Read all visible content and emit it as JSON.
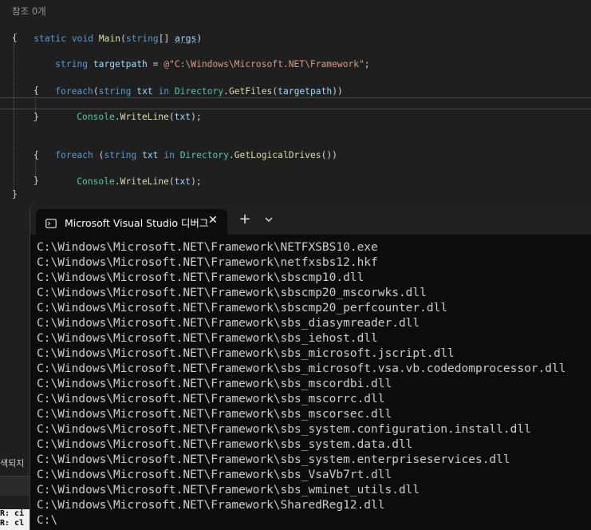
{
  "editor": {
    "codelens": "참조 0개",
    "lines": {
      "l1": {
        "kw": "static",
        "sp": " ",
        "kw2": "void",
        "sp2": " ",
        "fn": "Main",
        "p1": "(",
        "kw3": "string",
        "p2": "[] ",
        "var": "args",
        "p3": ")"
      },
      "l2": {
        "t": "{"
      },
      "l4": {
        "kw": "string",
        "sp": " ",
        "var": "targetpath",
        "eq": " = ",
        "str": "@\"C:\\Windows\\Microsoft.NET\\Framework\"",
        "end": ";"
      },
      "l6": {
        "kw": "foreach",
        "p1": "(",
        "kw2": "string",
        "sp": " ",
        "var": "txt",
        "sp2": " ",
        "kw3": "in",
        "sp3": " ",
        "ty": "Directory",
        "dot": ".",
        "fn": "GetFiles",
        "p2": "(",
        "var2": "targetpath",
        "p3": "))"
      },
      "l7": {
        "t": "{"
      },
      "l8": {
        "ty": "Console",
        "dot": ".",
        "fn": "WriteLine",
        "p1": "(",
        "var": "txt",
        "p2": ");"
      },
      "l9": {
        "t": "}"
      },
      "l11": {
        "kw": "foreach",
        "p1": " (",
        "kw2": "string",
        "sp": " ",
        "var": "txt",
        "sp2": " ",
        "kw3": "in",
        "sp3": " ",
        "ty": "Directory",
        "dot": ".",
        "fn": "GetLogicalDrives",
        "p2": "())"
      },
      "l12": {
        "t": "{"
      },
      "l13": {
        "ty": "Console",
        "dot": ".",
        "fn": "WriteLine",
        "p1": "(",
        "var": "txt",
        "p2": ");"
      },
      "l14": {
        "t": "}"
      },
      "l15": {
        "t": "}"
      }
    }
  },
  "side_pane": {
    "tab_fragment": "색되지",
    "term_lines": [
      "R: ci",
      "R: cl"
    ]
  },
  "terminal": {
    "tab_title": "Microsoft Visual Studio 디버그",
    "close_glyph": "✕",
    "new_tab_glyph": "+",
    "output": [
      "C:\\Windows\\Microsoft.NET\\Framework\\NETFXSBS10.exe",
      "C:\\Windows\\Microsoft.NET\\Framework\\netfxsbs12.hkf",
      "C:\\Windows\\Microsoft.NET\\Framework\\sbscmp10.dll",
      "C:\\Windows\\Microsoft.NET\\Framework\\sbscmp20_mscorwks.dll",
      "C:\\Windows\\Microsoft.NET\\Framework\\sbscmp20_perfcounter.dll",
      "C:\\Windows\\Microsoft.NET\\Framework\\sbs_diasymreader.dll",
      "C:\\Windows\\Microsoft.NET\\Framework\\sbs_iehost.dll",
      "C:\\Windows\\Microsoft.NET\\Framework\\sbs_microsoft.jscript.dll",
      "C:\\Windows\\Microsoft.NET\\Framework\\sbs_microsoft.vsa.vb.codedomprocessor.dll",
      "C:\\Windows\\Microsoft.NET\\Framework\\sbs_mscordbi.dll",
      "C:\\Windows\\Microsoft.NET\\Framework\\sbs_mscorrc.dll",
      "C:\\Windows\\Microsoft.NET\\Framework\\sbs_mscorsec.dll",
      "C:\\Windows\\Microsoft.NET\\Framework\\sbs_system.configuration.install.dll",
      "C:\\Windows\\Microsoft.NET\\Framework\\sbs_system.data.dll",
      "C:\\Windows\\Microsoft.NET\\Framework\\sbs_system.enterpriseservices.dll",
      "C:\\Windows\\Microsoft.NET\\Framework\\sbs_VsaVb7rt.dll",
      "C:\\Windows\\Microsoft.NET\\Framework\\sbs_wminet_utils.dll",
      "C:\\Windows\\Microsoft.NET\\Framework\\SharedReg12.dll",
      "C:\\"
    ]
  },
  "colors": {
    "editor_bg": "#1f1f1f",
    "keyword": "#569cd6",
    "type": "#4ec9b0",
    "method": "#dcdcaa",
    "string": "#d69d85",
    "variable": "#9cdcfe",
    "terminal_bg": "#0c0c0c",
    "terminal_text": "#cccccc"
  },
  "icons": {
    "tab_icon": "terminal-app-icon",
    "close": "close-icon",
    "new_tab": "plus-icon",
    "dropdown": "chevron-down-icon"
  }
}
